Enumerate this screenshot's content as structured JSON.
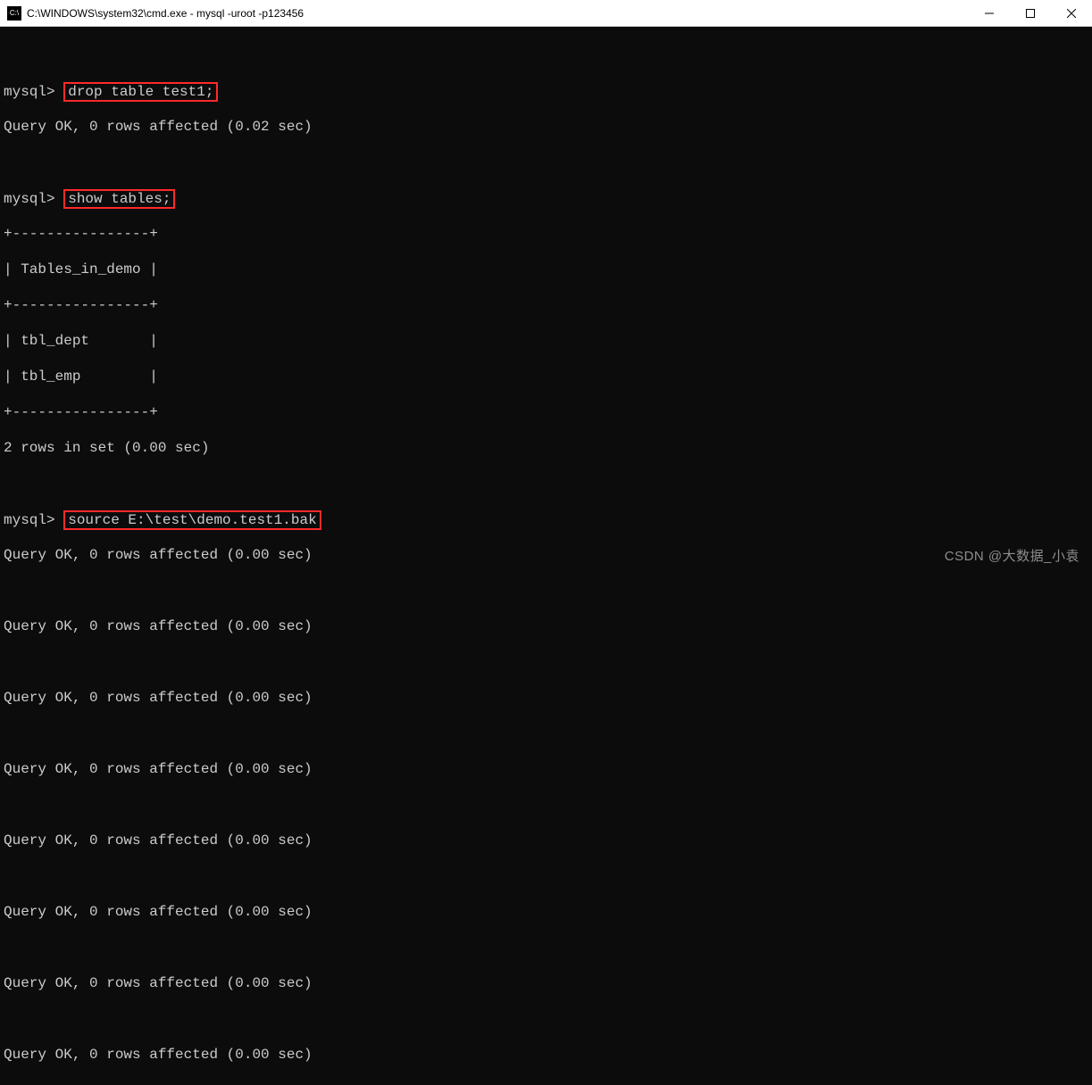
{
  "window": {
    "title": "C:\\WINDOWS\\system32\\cmd.exe - mysql  -uroot -p123456",
    "icon_label": "C:\\"
  },
  "prompt": "mysql> ",
  "cmd1": "drop table test1;",
  "res1": "Query OK, 0 rows affected (0.02 sec)",
  "cmd2": "show tables;",
  "tbl_border_top": "+----------------+",
  "tbl_header": "| Tables_in_demo |",
  "tbl_border_mid": "+----------------+",
  "tbl_row1": "| tbl_dept       |",
  "tbl_row2": "| tbl_emp        |",
  "tbl_border_bot": "+----------------+",
  "res2": "2 rows in set (0.00 sec)",
  "cmd3": "source E:\\test\\demo.test1.bak",
  "res3": "Query OK, 0 rows affected (0.00 sec)",
  "watermark": "CSDN @大数据_小袁"
}
